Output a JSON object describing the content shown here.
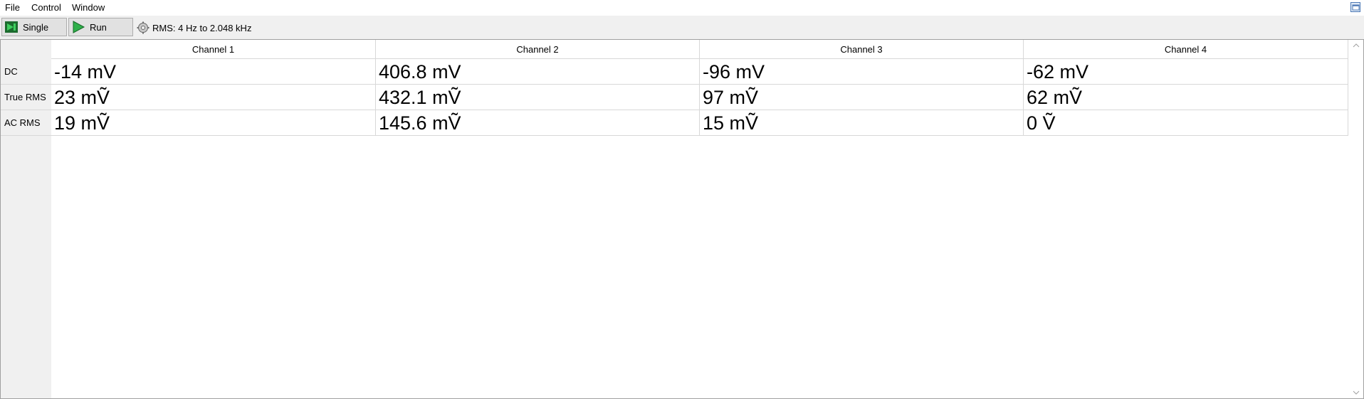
{
  "menu": {
    "file": "File",
    "control": "Control",
    "window": "Window"
  },
  "toolbar": {
    "single_label": "Single",
    "run_label": "Run",
    "rms_info": "RMS: 4 Hz to 2.048 kHz"
  },
  "table": {
    "columns": [
      "Channel 1",
      "Channel 2",
      "Channel 3",
      "Channel 4"
    ],
    "rows": [
      {
        "label": "DC",
        "values": [
          "-14 mV",
          "406.8 mV",
          "-96 mV",
          "-62 mV"
        ]
      },
      {
        "label": "True RMS",
        "values": [
          "23 mṼ",
          "432.1 mṼ",
          "97 mṼ",
          "62 mṼ"
        ]
      },
      {
        "label": "AC RMS",
        "values": [
          "19 mṼ",
          "145.6 mṼ",
          "15 mṼ",
          "0 Ṽ"
        ]
      }
    ]
  },
  "colors": {
    "accent_green": "#1e9a3a",
    "background": "#f0f0f0",
    "table_background": "#ffffff"
  },
  "icons": {
    "single": "single-step-icon",
    "run": "play-icon",
    "rms": "gear-icon",
    "restore": "window-restore-icon"
  }
}
